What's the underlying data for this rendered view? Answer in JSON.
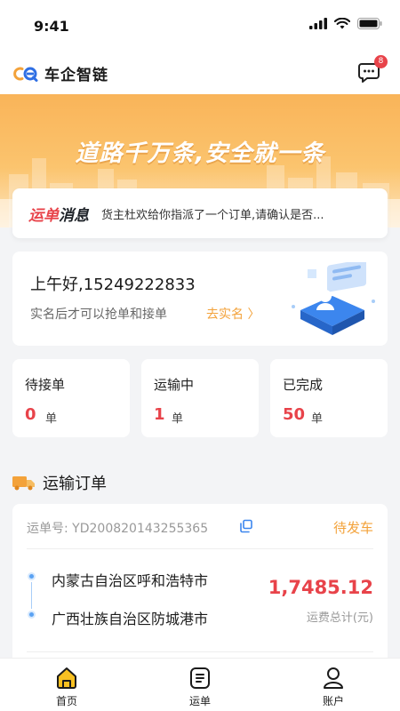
{
  "status_bar": {
    "time": "9:41"
  },
  "header": {
    "app_name": "车企智链",
    "message_badge": "8"
  },
  "banner": {
    "slogan": "道路千万条,安全就一条"
  },
  "notice": {
    "title_part1": "运单",
    "title_part2": "消息",
    "text": "货主杜欢给你指派了一个订单,请确认是否..."
  },
  "greeting": {
    "title": "上午好,15249222833",
    "subtitle": "实名后才可以抢单和接单",
    "link": "去实名 〉"
  },
  "stats": [
    {
      "label": "待接单",
      "value": "0",
      "unit": "单"
    },
    {
      "label": "运输中",
      "value": "1",
      "unit": "单"
    },
    {
      "label": "已完成",
      "value": "50",
      "unit": "单"
    }
  ],
  "section": {
    "title": "运输订单"
  },
  "order": {
    "no_label": "运单号:",
    "no_value": "YD200820143255365",
    "status": "待发车",
    "from": "内蒙古自治区呼和浩特市",
    "to": "广西壮族自治区防城港市",
    "fee": "1,7485.12",
    "fee_label": "运费总计(元)"
  },
  "tabbar": [
    {
      "label": "首页",
      "icon": "home-icon"
    },
    {
      "label": "运单",
      "icon": "waybill-icon"
    },
    {
      "label": "账户",
      "icon": "account-icon"
    }
  ],
  "colors": {
    "accent": "#f3a23a",
    "red": "#e8434a",
    "brand_blue": "#2f6fe4"
  }
}
